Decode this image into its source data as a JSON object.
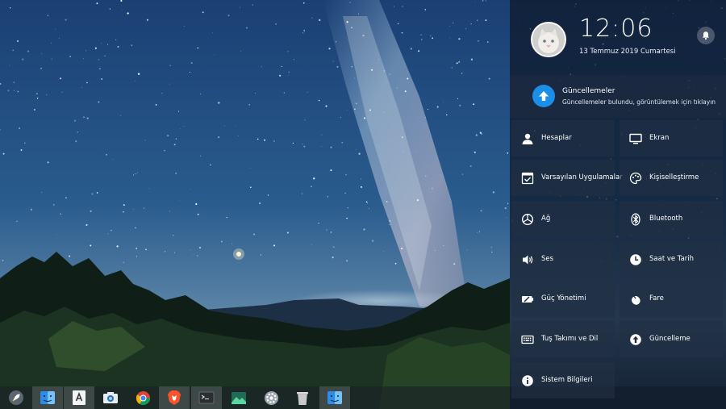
{
  "clock": {
    "time": "12:06",
    "date": "13 Temmuz 2019 Cumartesi"
  },
  "updates": {
    "title": "Güncellemeler",
    "subtitle": "Güncellemeler bulundu, görüntülemek için tıklayın"
  },
  "settings_tiles": [
    {
      "label": "Hesaplar",
      "icon": "user-icon"
    },
    {
      "label": "Ekran",
      "icon": "display-icon"
    },
    {
      "label": "Varsayılan Uygulamalar",
      "icon": "default-apps-icon"
    },
    {
      "label": "Kişiselleştirme",
      "icon": "personalization-icon"
    },
    {
      "label": "Ağ",
      "icon": "network-icon"
    },
    {
      "label": "Bluetooth",
      "icon": "bluetooth-icon"
    },
    {
      "label": "Ses",
      "icon": "speaker-icon"
    },
    {
      "label": "Saat ve Tarih",
      "icon": "clock-icon"
    },
    {
      "label": "Güç Yönetimi",
      "icon": "battery-icon"
    },
    {
      "label": "Fare",
      "icon": "mouse-icon"
    },
    {
      "label": "Tuş Takımı ve Dil",
      "icon": "keyboard-icon"
    },
    {
      "label": "Güncelleme",
      "icon": "update-icon"
    },
    {
      "label": "Sistem Bilgileri",
      "icon": "info-icon"
    }
  ],
  "dock": [
    {
      "name": "launcher",
      "icon": "rocket-icon"
    },
    {
      "name": "file-manager",
      "icon": "finder-icon"
    },
    {
      "name": "app-store",
      "icon": "app-store-icon"
    },
    {
      "name": "screenshot",
      "icon": "camera-icon"
    },
    {
      "name": "chrome",
      "icon": "chrome-icon"
    },
    {
      "name": "brave",
      "icon": "brave-icon"
    },
    {
      "name": "terminal",
      "icon": "terminal-icon"
    },
    {
      "name": "image-viewer",
      "icon": "image-icon"
    },
    {
      "name": "system-settings",
      "icon": "settings-icon"
    },
    {
      "name": "trash",
      "icon": "trash-icon"
    },
    {
      "name": "file-manager-2",
      "icon": "finder-icon"
    }
  ]
}
